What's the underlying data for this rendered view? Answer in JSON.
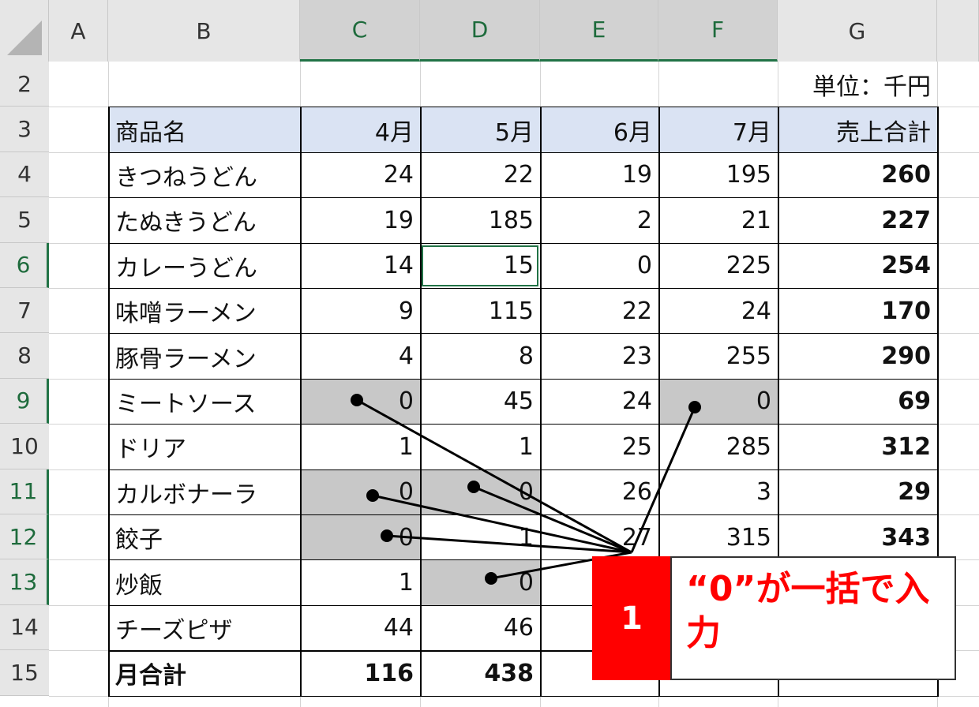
{
  "columns": [
    "A",
    "B",
    "C",
    "D",
    "E",
    "F",
    "G"
  ],
  "rows": [
    "2",
    "3",
    "4",
    "5",
    "6",
    "7",
    "8",
    "9",
    "10",
    "11",
    "12",
    "13",
    "14",
    "15"
  ],
  "unit_label": "単位：千円",
  "table": {
    "header": [
      "商品名",
      "4月",
      "5月",
      "6月",
      "7月",
      "売上合計"
    ],
    "body": [
      [
        "きつねうどん",
        "24",
        "22",
        "19",
        "195",
        "260"
      ],
      [
        "たぬきうどん",
        "19",
        "185",
        "2",
        "21",
        "227"
      ],
      [
        "カレーうどん",
        "14",
        "15",
        "0",
        "225",
        "254"
      ],
      [
        "味噌ラーメン",
        "9",
        "115",
        "22",
        "24",
        "170"
      ],
      [
        "豚骨ラーメン",
        "4",
        "8",
        "23",
        "255",
        "290"
      ],
      [
        "ミートソース",
        "0",
        "45",
        "24",
        "0",
        "69"
      ],
      [
        "ドリア",
        "1",
        "1",
        "25",
        "285",
        "312"
      ],
      [
        "カルボナーラ",
        "0",
        "0",
        "26",
        "3",
        "29"
      ],
      [
        "餃子",
        "0",
        "1",
        "27",
        "315",
        "343"
      ],
      [
        "炒飯",
        "1",
        "0",
        "",
        "",
        ""
      ],
      [
        "チーズピザ",
        "44",
        "46",
        "",
        "",
        ""
      ],
      [
        "月合計",
        "116",
        "438",
        "",
        "",
        ""
      ]
    ]
  },
  "gray_cells": [
    [
      5,
      1
    ],
    [
      5,
      4
    ],
    [
      7,
      1
    ],
    [
      7,
      2
    ],
    [
      8,
      1
    ],
    [
      9,
      2
    ]
  ],
  "active_cell": "E6",
  "callout": {
    "number": "1",
    "text": "“0”が一括で入力"
  },
  "colors": {
    "header_fill": "#dae3f3",
    "gray_fill": "#c8c8c8",
    "callout_red": "#ff0000",
    "selection_green": "#217346"
  }
}
